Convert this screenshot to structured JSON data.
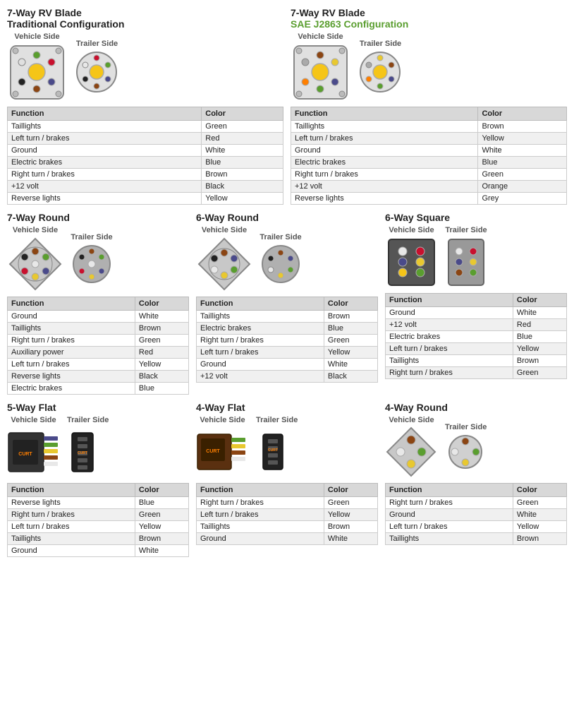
{
  "sections": {
    "s1": {
      "title": "7-Way RV Blade",
      "subtitle": "Traditional Configuration",
      "subtitleColor": "black",
      "connectors": [
        {
          "label": "Vehicle Side",
          "type": "7way-rv-vehicle-traditional"
        },
        {
          "label": "Trailer Side",
          "type": "7way-rv-trailer-traditional"
        }
      ],
      "table": {
        "headers": [
          "Function",
          "Color"
        ],
        "rows": [
          [
            "Taillights",
            "Green"
          ],
          [
            "Left turn / brakes",
            "Red"
          ],
          [
            "Ground",
            "White"
          ],
          [
            "Electric brakes",
            "Blue"
          ],
          [
            "Right turn / brakes",
            "Brown"
          ],
          [
            "+12 volt",
            "Black"
          ],
          [
            "Reverse lights",
            "Yellow"
          ]
        ]
      }
    },
    "s2": {
      "title": "7-Way RV Blade",
      "subtitle": "SAE J2863 Configuration",
      "subtitleColor": "green",
      "connectors": [
        {
          "label": "Vehicle Side",
          "type": "7way-rv-vehicle-sae"
        },
        {
          "label": "Trailer Side",
          "type": "7way-rv-trailer-sae"
        }
      ],
      "table": {
        "headers": [
          "Function",
          "Color"
        ],
        "rows": [
          [
            "Taillights",
            "Brown"
          ],
          [
            "Left turn / brakes",
            "Yellow"
          ],
          [
            "Ground",
            "White"
          ],
          [
            "Electric brakes",
            "Blue"
          ],
          [
            "Right turn / brakes",
            "Green"
          ],
          [
            "+12 volt",
            "Orange"
          ],
          [
            "Reverse lights",
            "Grey"
          ]
        ]
      }
    },
    "s3": {
      "title": "7-Way Round",
      "connectors": [
        {
          "label": "Vehicle Side",
          "type": "7way-round-vehicle"
        },
        {
          "label": "Trailer Side",
          "type": "7way-round-trailer"
        }
      ],
      "table": {
        "headers": [
          "Function",
          "Color"
        ],
        "rows": [
          [
            "Ground",
            "White"
          ],
          [
            "Taillights",
            "Brown"
          ],
          [
            "Right turn / brakes",
            "Green"
          ],
          [
            "Auxiliary power",
            "Red"
          ],
          [
            "Left turn / brakes",
            "Yellow"
          ],
          [
            "Reverse lights",
            "Black"
          ],
          [
            "Electric brakes",
            "Blue"
          ]
        ]
      }
    },
    "s4": {
      "title": "6-Way Round",
      "connectors": [
        {
          "label": "Vehicle Side",
          "type": "6way-round-vehicle"
        },
        {
          "label": "Trailer Side",
          "type": "6way-round-trailer"
        }
      ],
      "table": {
        "headers": [
          "Function",
          "Color"
        ],
        "rows": [
          [
            "Taillights",
            "Brown"
          ],
          [
            "Electric brakes",
            "Blue"
          ],
          [
            "Right turn / brakes",
            "Green"
          ],
          [
            "Left turn / brakes",
            "Yellow"
          ],
          [
            "Ground",
            "White"
          ],
          [
            "+12 volt",
            "Black"
          ]
        ]
      }
    },
    "s5": {
      "title": "6-Way Square",
      "connectors": [
        {
          "label": "Vehicle Side",
          "type": "6way-square-vehicle"
        },
        {
          "label": "Trailer Side",
          "type": "6way-square-trailer"
        }
      ],
      "table": {
        "headers": [
          "Function",
          "Color"
        ],
        "rows": [
          [
            "Ground",
            "White"
          ],
          [
            "+12 volt",
            "Red"
          ],
          [
            "Electric brakes",
            "Blue"
          ],
          [
            "Left turn / brakes",
            "Yellow"
          ],
          [
            "Taillights",
            "Brown"
          ],
          [
            "Right turn / brakes",
            "Green"
          ]
        ]
      }
    },
    "s6": {
      "title": "5-Way Flat",
      "connectors": [
        {
          "label": "Vehicle Side",
          "type": "5way-flat-vehicle"
        },
        {
          "label": "Trailer Side",
          "type": "5way-flat-trailer"
        }
      ],
      "table": {
        "headers": [
          "Function",
          "Color"
        ],
        "rows": [
          [
            "Reverse lights",
            "Blue"
          ],
          [
            "Right turn / brakes",
            "Green"
          ],
          [
            "Left turn / brakes",
            "Yellow"
          ],
          [
            "Taillights",
            "Brown"
          ],
          [
            "Ground",
            "White"
          ]
        ]
      }
    },
    "s7": {
      "title": "4-Way Flat",
      "connectors": [
        {
          "label": "Vehicle Side",
          "type": "4way-flat-vehicle"
        },
        {
          "label": "Trailer Side",
          "type": "4way-flat-trailer"
        }
      ],
      "table": {
        "headers": [
          "Function",
          "Color"
        ],
        "rows": [
          [
            "Right turn / brakes",
            "Green"
          ],
          [
            "Left turn / brakes",
            "Yellow"
          ],
          [
            "Taillights",
            "Brown"
          ],
          [
            "Ground",
            "White"
          ]
        ]
      }
    },
    "s8": {
      "title": "4-Way Round",
      "connectors": [
        {
          "label": "Vehicle Side",
          "type": "4way-round-vehicle"
        },
        {
          "label": "Trailer Side",
          "type": "4way-round-trailer"
        }
      ],
      "table": {
        "headers": [
          "Function",
          "Color"
        ],
        "rows": [
          [
            "Right turn / brakes",
            "Green"
          ],
          [
            "Ground",
            "White"
          ],
          [
            "Left turn / brakes",
            "Yellow"
          ],
          [
            "Taillights",
            "Brown"
          ]
        ]
      }
    }
  }
}
